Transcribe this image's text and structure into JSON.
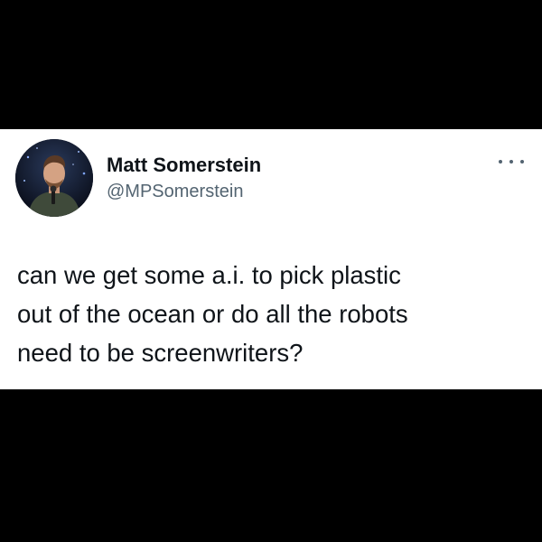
{
  "tweet": {
    "author_name": "Matt Somerstein",
    "author_handle": "@MPSomerstein",
    "more_icon": "more-horizontal-icon",
    "avatar_icon": "avatar-photo",
    "text_lines": [
      "can we get some a.i. to pick plastic",
      "out of the ocean or do all the robots",
      "need to be screenwriters?"
    ]
  },
  "colors": {
    "background": "#000000",
    "card": "#ffffff",
    "name_text": "#0f1419",
    "handle_text": "#536471"
  }
}
